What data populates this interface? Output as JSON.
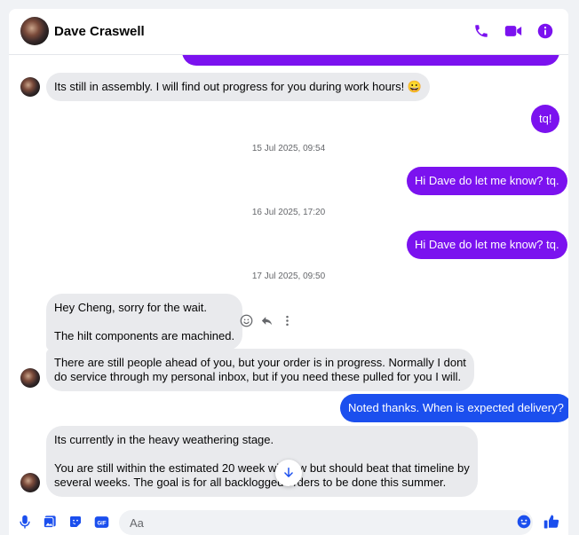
{
  "contact": {
    "name": "Dave Craswell"
  },
  "header_icons": [
    "phone-icon",
    "video-icon",
    "info-icon"
  ],
  "colors": {
    "accent": "#7b12ef",
    "outgoing_purple": "#7b12ef",
    "outgoing_blue": "#1b4fee",
    "incoming": "#e9eaed",
    "timestamp": "#65676b"
  },
  "messages": {
    "m1": "Its still in assembly. I will find out progress for you during work hours! 😀",
    "m2": "tq!",
    "t1": "15 Jul 2025, 09:54",
    "m3": "Hi Dave do let me know? tq.",
    "t2": "16 Jul 2025, 17:20",
    "m4": "Hi Dave do let me know? tq.",
    "t3": "17 Jul 2025, 09:50",
    "m5_line1": "Hey Cheng, sorry for the wait.",
    "m5_line2": "The hilt components are machined.",
    "m6_line1": "There are still people ahead of you, but your order is in progress. Normally I dont",
    "m6_line2": "do service through my personal inbox, but if you need these pulled for you I will.",
    "m7": "Noted thanks. When is expected delivery?",
    "m8_line1": "Its currently in the heavy weathering stage.",
    "m8_line2": "You are still within the estimated 20 week window but should beat that timeline by",
    "m8_line3": "several weeks. The goal is for all backlogged orders to be done this summer."
  },
  "message_actions": [
    "smile-react-icon",
    "reply-icon",
    "more-icon"
  ],
  "composer": {
    "placeholder": "Aa",
    "icons": [
      "microphone-icon",
      "photo-icon",
      "sticker-icon",
      "gif-icon",
      "emoji-icon",
      "thumbs-up-icon"
    ],
    "gif_label": "GIF"
  }
}
